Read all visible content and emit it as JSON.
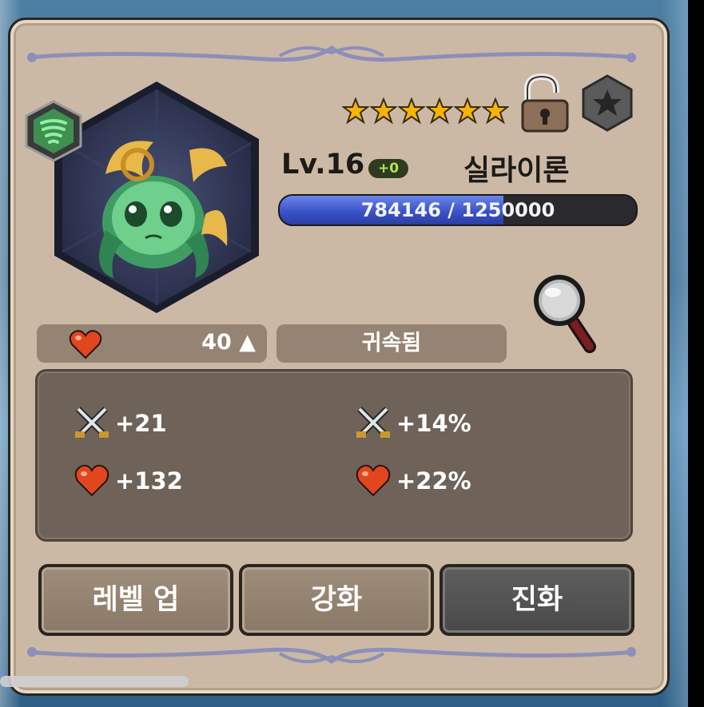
{
  "card": {
    "star_count": 6,
    "level_text": "Lv.16",
    "level_bonus": "+0",
    "name": "실라이론",
    "exp": {
      "current": 784146,
      "max": 1250000,
      "text": "784146 / 1250000"
    },
    "heart_value": "40 ▲",
    "status": "귀속됨",
    "stats": [
      {
        "icon": "swords-icon",
        "value": "+21"
      },
      {
        "icon": "swords-icon",
        "value": "+14%"
      },
      {
        "icon": "heart-icon",
        "value": "+132"
      },
      {
        "icon": "heart-icon",
        "value": "+22%"
      }
    ],
    "buttons": {
      "level_up": "레벨 업",
      "enhance": "강화",
      "evolve": "진화"
    }
  },
  "icons": {
    "element_badge": "wind-element-icon",
    "lock": "unlocked-padlock-icon",
    "favorite": "star-hexagon-icon",
    "inspect": "magnifier-icon"
  },
  "colors": {
    "panel_bg": "#cbb9a6",
    "exp_fill": "#3b53c8",
    "star": "#f5b400",
    "stats_bg": "#6f6359"
  }
}
